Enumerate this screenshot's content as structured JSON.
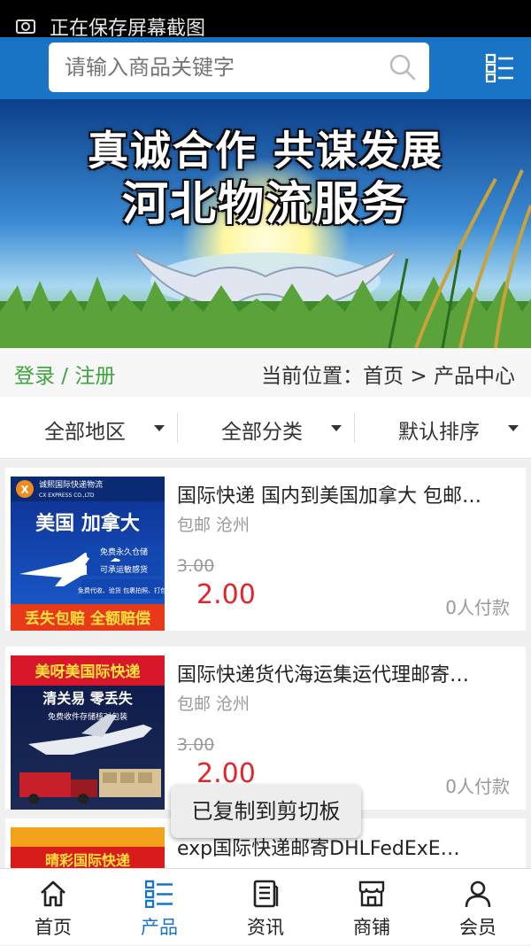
{
  "status_bar": {
    "text": "正在保存屏幕截图"
  },
  "search": {
    "placeholder": "请输入商品关键字"
  },
  "banner": {
    "line1": "真诚合作 共谋发展",
    "line2": "河北物流服务"
  },
  "infobar": {
    "login": "登录 / 注册",
    "location": "当前位置：首页 > 产品中心"
  },
  "filters": [
    {
      "label": "全部地区"
    },
    {
      "label": "全部分类"
    },
    {
      "label": "默认排序"
    }
  ],
  "products": [
    {
      "title": "国际快递 国内到美国加拿大 包邮…",
      "meta": "包邮 沧州",
      "old_price": "3.00",
      "price": "2.00",
      "sold": "0人付款",
      "thumb": {
        "brand": "诚熙国际快递物流",
        "brand_en": "CX EXPRESS CO.,LTD",
        "headline": "美国 加拿大",
        "tags": [
          "免费永久仓储",
          "可承运敏感货",
          "免费代收、验货 包裹拍照、打包"
        ],
        "footer": "丢失包赔 全额赔偿"
      }
    },
    {
      "title": "国际快递货代海运集运代理邮寄…",
      "meta": "包邮 沧州",
      "old_price": "3.00",
      "price": "2.00",
      "sold": "0人付款",
      "thumb": {
        "headline": "美呀美国际快递",
        "sub": "清关易 零丢失",
        "sub2": "免费收件存储核对包装"
      }
    },
    {
      "title": "exp国际快递邮寄DHLFedExE…",
      "thumb": {
        "headline": "晴彩国际快递"
      }
    }
  ],
  "toast": {
    "text": "已复制到剪切板"
  },
  "nav": [
    {
      "label": "首页",
      "icon": "home-icon"
    },
    {
      "label": "产品",
      "icon": "product-list-icon",
      "active": true
    },
    {
      "label": "资讯",
      "icon": "news-icon"
    },
    {
      "label": "商铺",
      "icon": "shop-icon"
    },
    {
      "label": "会员",
      "icon": "member-icon"
    }
  ],
  "colors": {
    "primary": "#1a74c6",
    "price": "#e4232a",
    "login": "#3aa53a"
  }
}
